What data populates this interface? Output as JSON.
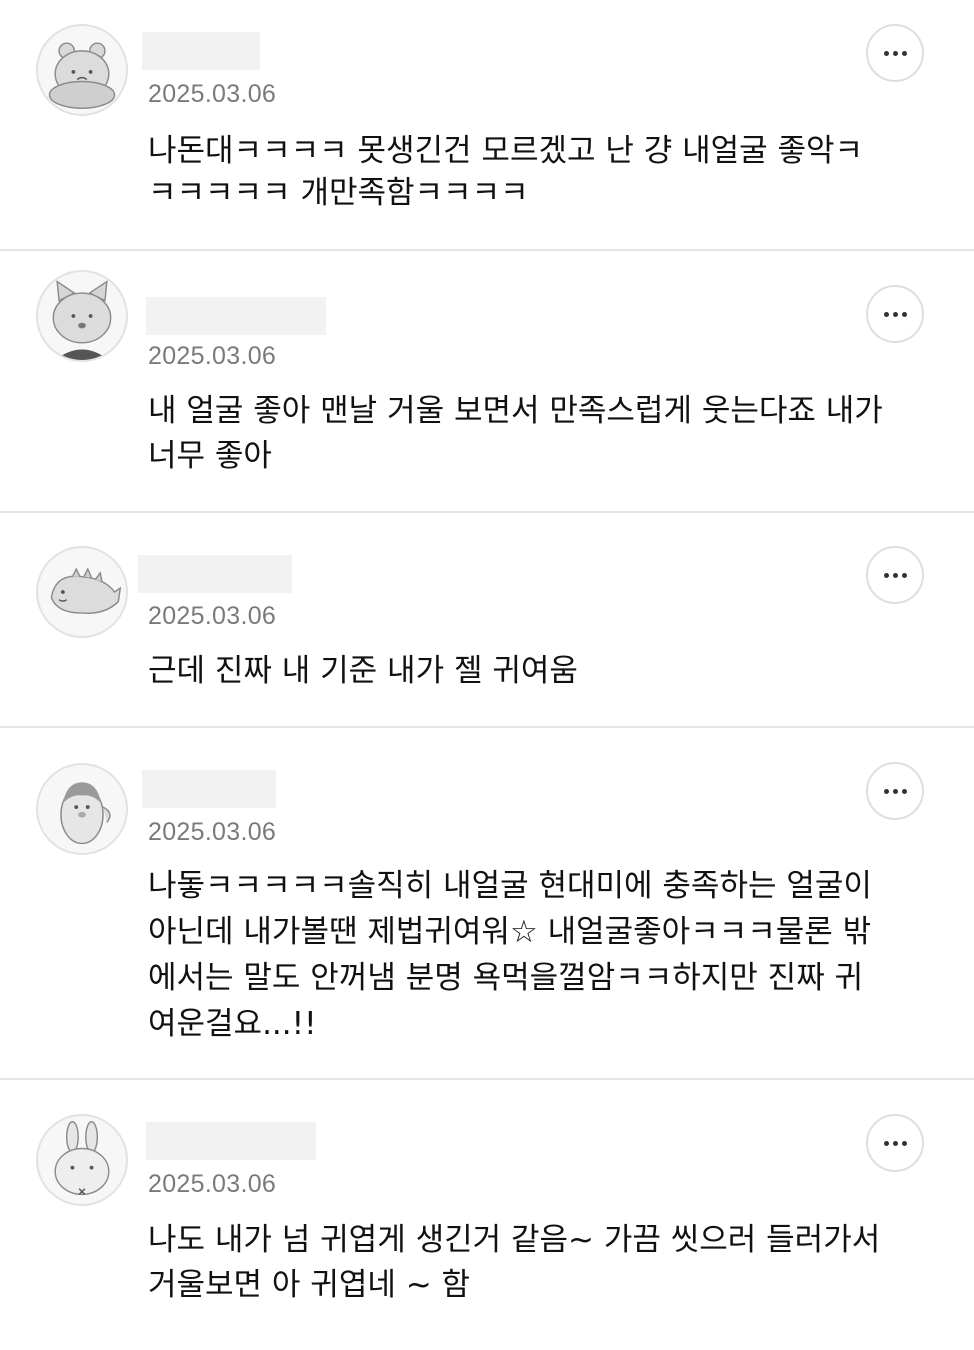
{
  "comments": [
    {
      "avatar": "bear-face-icon",
      "date": "2025.03.06",
      "lines": [
        "나돈대ㅋㅋㅋㅋ 못생긴건 모르겠고 난 걍 내얼굴 좋악ㅋ",
        "ㅋㅋㅋㅋㅋ 개만족함ㅋㅋㅋㅋ"
      ],
      "more_label": "•••"
    },
    {
      "avatar": "cat-face-icon",
      "date": "2025.03.06",
      "lines": [
        "내 얼굴 좋아 맨날 거울 보면서 만족스럽게 웃는다죠 내가",
        "너무 좋아"
      ],
      "more_label": "•••"
    },
    {
      "avatar": "dinosaur-icon",
      "date": "2025.03.06",
      "lines": [
        "근데 진짜 내 기준 내가 젤 귀여움"
      ],
      "more_label": "•••"
    },
    {
      "avatar": "penguin-icon",
      "date": "2025.03.06",
      "lines": [
        "나돟ㅋㅋㅋㅋㅋ솔직히 내얼굴 현대미에 충족하는 얼굴이",
        "아닌데 내가볼땐 제법귀여워☆ 내얼굴좋아ㅋㅋㅋ물론 밖",
        "에서는 말도 안꺼냄 분명 욕먹을껄암ㅋㅋ하지만 진짜 귀",
        "여운걸요...!!"
      ],
      "more_label": "•••"
    },
    {
      "avatar": "rabbit-face-icon",
      "date": "2025.03.06",
      "lines": [
        "나도 내가 넘 귀엽게 생긴거 같음~ 가끔 씻으러 들러가서",
        "거울보면 아 귀엽네 ~ 함"
      ],
      "more_label": "•••"
    }
  ]
}
